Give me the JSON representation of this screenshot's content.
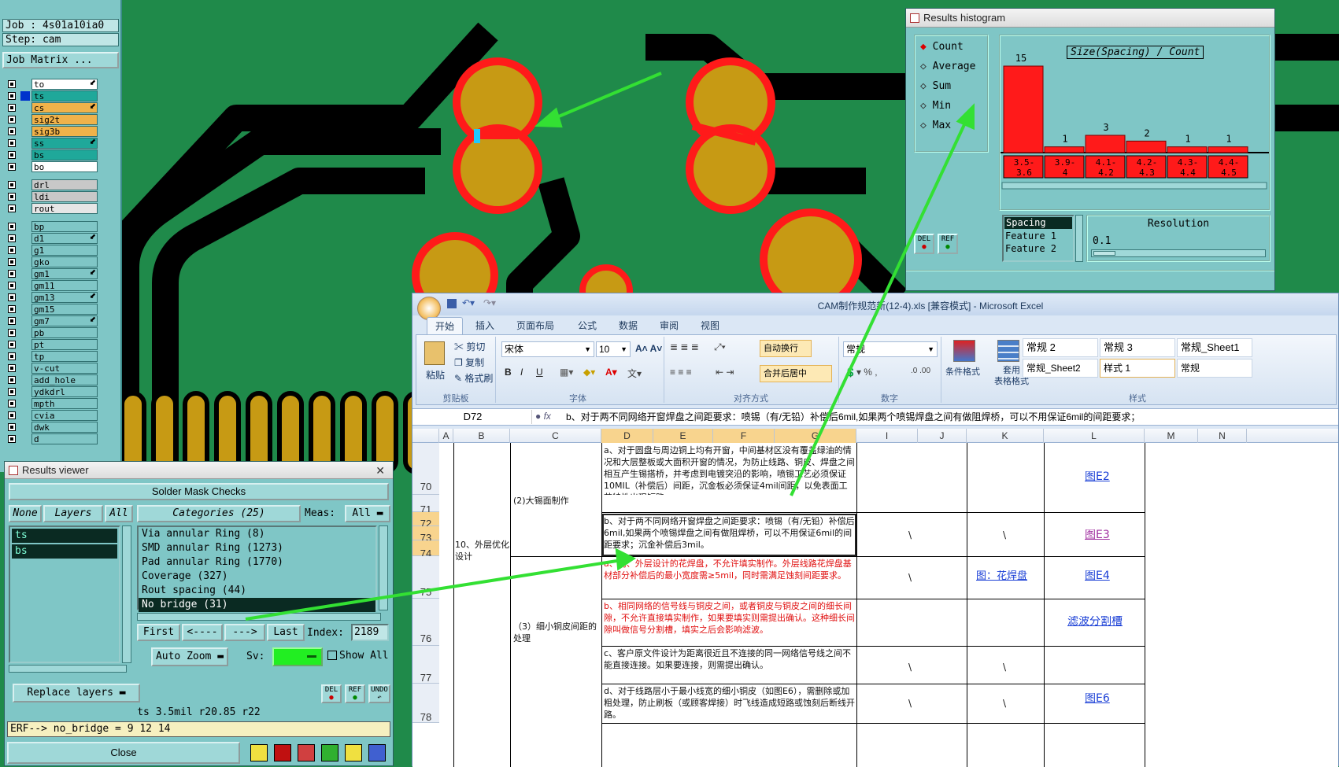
{
  "job": {
    "job_line": "Job : 4s01a10ia0",
    "step_line": "Step: cam",
    "matrix_button": "Job Matrix ..."
  },
  "layers": [
    {
      "name": "to",
      "color": "#ffffff",
      "mark": true
    },
    {
      "name": "ts",
      "color": "#1fa89a",
      "mark": false
    },
    {
      "name": "cs",
      "color": "#f0b24a",
      "mark": true
    },
    {
      "name": "sig2t",
      "color": "#f0b24a",
      "mark": false
    },
    {
      "name": "sig3b",
      "color": "#f0b24a",
      "mark": false
    },
    {
      "name": "ss",
      "color": "#1fa89a",
      "mark": true
    },
    {
      "name": "bs",
      "color": "#1fa89a",
      "mark": false
    },
    {
      "name": "bo",
      "color": "#ffffff",
      "mark": false
    },
    {
      "name": "drl",
      "color": "#c8c8c8",
      "mark": false
    },
    {
      "name": "ldi",
      "color": "#c8c8c8",
      "mark": false
    },
    {
      "name": "rout",
      "color": "#e6e6e6",
      "mark": false
    },
    {
      "name": "bp",
      "color": "#7fc6c6",
      "mark": false
    },
    {
      "name": "d1",
      "color": "#7fc6c6",
      "mark": true
    },
    {
      "name": "g1",
      "color": "#7fc6c6",
      "mark": false
    },
    {
      "name": "gko",
      "color": "#7fc6c6",
      "mark": false
    },
    {
      "name": "gm1",
      "color": "#7fc6c6",
      "mark": true
    },
    {
      "name": "gm11",
      "color": "#7fc6c6",
      "mark": false
    },
    {
      "name": "gm13",
      "color": "#7fc6c6",
      "mark": true
    },
    {
      "name": "gm15",
      "color": "#7fc6c6",
      "mark": false
    },
    {
      "name": "gm7",
      "color": "#7fc6c6",
      "mark": true
    },
    {
      "name": "pb",
      "color": "#7fc6c6",
      "mark": false
    },
    {
      "name": "pt",
      "color": "#7fc6c6",
      "mark": false
    },
    {
      "name": "tp",
      "color": "#7fc6c6",
      "mark": false
    },
    {
      "name": "v-cut",
      "color": "#7fc6c6",
      "mark": false
    },
    {
      "name": "add_hole",
      "color": "#7fc6c6",
      "mark": false
    },
    {
      "name": "ydkdrl",
      "color": "#7fc6c6",
      "mark": false
    },
    {
      "name": "mpth",
      "color": "#7fc6c6",
      "mark": false
    },
    {
      "name": "cvia",
      "color": "#7fc6c6",
      "mark": false
    },
    {
      "name": "dwk",
      "color": "#7fc6c6",
      "mark": false
    },
    {
      "name": "d",
      "color": "#7fc6c6",
      "mark": false
    }
  ],
  "results_viewer": {
    "title": "Results viewer",
    "header": "Solder Mask Checks",
    "none_btn": "None",
    "layers_btn": "Layers",
    "all_btn": "All",
    "layer_list": [
      "ts",
      "bs"
    ],
    "categories_btn": "Categories (25)",
    "meas_label": "Meas:",
    "meas_value": "All",
    "categories": [
      "Via annular Ring (8)",
      "SMD annular Ring (1273)",
      "Pad annular Ring (1770)",
      "Coverage (327)",
      "Rout spacing (44)",
      "No bridge (31)"
    ],
    "first_btn": "First",
    "prev_btn": "<----",
    "next_btn": "--->",
    "last_btn": "Last",
    "index_label": "Index:",
    "index_value": "2189",
    "autozoom_btn": "Auto Zoom",
    "sv_label": "Sv:",
    "show_all": "Show All",
    "replace_btn": "Replace layers",
    "del_label": "DEL",
    "ref_label": "REF",
    "undo_label": "UNDO",
    "status1": "ts 3.5mil  r20.85  r22",
    "status2": "ERF--> no_bridge = 9 12 14",
    "close_btn": "Close"
  },
  "histogram": {
    "title": "Results histogram",
    "modes": [
      "Count",
      "Average",
      "Sum",
      "Min",
      "Max"
    ],
    "chart_title": "Size(Spacing) / Count",
    "bins": [
      {
        "label": "3.5-\n3.6",
        "count": 15
      },
      {
        "label": "3.9-\n4",
        "count": 1
      },
      {
        "label": "4.1-\n4.2",
        "count": 3
      },
      {
        "label": "4.2-\n4.3",
        "count": 2
      },
      {
        "label": "4.3-\n4.4",
        "count": 1
      },
      {
        "label": "4.4-\n4.5",
        "count": 1
      }
    ],
    "list": [
      "Spacing",
      "Feature 1",
      "Feature 2"
    ],
    "resolution_label": "Resolution",
    "resolution_value": "0.1",
    "del_label": "DEL",
    "ref_label": "REF"
  },
  "excel": {
    "title": "CAM制作规范新(12-4).xls [兼容模式] - Microsoft Excel",
    "tabs": [
      "开始",
      "插入",
      "页面布局",
      "公式",
      "数据",
      "审阅",
      "视图"
    ],
    "clipboard": {
      "paste": "粘贴",
      "cut": "剪切",
      "copy": "复制",
      "format_painter": "格式刷",
      "group": "剪贴板"
    },
    "font": {
      "name": "宋体",
      "size": "10",
      "group": "字体"
    },
    "align": {
      "wrap": "自动换行",
      "merge": "合并后居中",
      "group": "对齐方式"
    },
    "number": {
      "format": "常规",
      "group": "数字"
    },
    "styles": {
      "cond": "条件格式",
      "table": "套用\n表格格式",
      "cells": [
        "常规 2",
        "常规 3",
        "常规_Sheet1",
        "常规_Sheet2",
        "样式 1",
        "常规"
      ],
      "group": "样式"
    },
    "name_box": "D72",
    "formula": "b、对于两不同网络开窗焊盘之间距要求：喷锡（有/无铅）补偿后6mil,如果两个喷锡焊盘之间有做阻焊桥，可以不用保证6mil的间距要求；",
    "columns": [
      "A",
      "B",
      "C",
      "D",
      "E",
      "F",
      "G",
      "I",
      "J",
      "K",
      "L",
      "M",
      "N"
    ],
    "rows": [
      "70",
      "71",
      "72",
      "73",
      "74",
      "75",
      "76",
      "77",
      "78"
    ],
    "b_text": "10、外层优化设计",
    "c1_text": "(2)大锡面制作",
    "c2_text": "（3）细小铜皮间距的处理",
    "d_texts": [
      "a、对于圆盘与周边铜上均有开窗，中间基材区没有覆盖绿油的情况和大层整板或大面积开窗的情况，为防止线路、铜皮、焊盘之间相互产生锡搭桥，并考虑到电镀突沿的影响，喷锡工艺必须保证10MIL（补偿后）间距，沉金板必须保证4mil间距，以免表面工艺特性出现短路。",
      "b、对于两不同网络开窗焊盘之间距要求：喷锡（有/无铅）补偿后6mil,如果两个喷锡焊盘之间有做阻焊桥，可以不用保证6mil的间距要求；沉金补偿后3mil。",
      "a、内、外层设计的花焊盘，不允许填实制作。外层线路花焊盘基材部分补偿后的最小宽度需≥5mil，同时需满足蚀刻间距要求。",
      "b、相同网络的信号线与铜皮之间，或者铜皮与铜皮之间的细长间隙，不允许直接填实制作，如果要填实则需提出确认。这种细长间隙叫做信号分割槽，填实之后会影响滤波。",
      "c、客户原文件设计为距离很近且不连接的同一网络信号线之间不能直接连接。如果要连接，则需提出确认。",
      "d、对于线路层小于最小线宽的细小铜皮（如图E6），需删除或加粗处理，防止刷板（或顾客焊接）时飞线造成短路或蚀刻后断线开路。"
    ],
    "i_mark": "\\",
    "k_mark": "\\",
    "k_link": "图：花焊盘",
    "l_links": [
      "图E2",
      "图E3",
      "图E4",
      "滤波分割槽",
      "图E6"
    ]
  }
}
